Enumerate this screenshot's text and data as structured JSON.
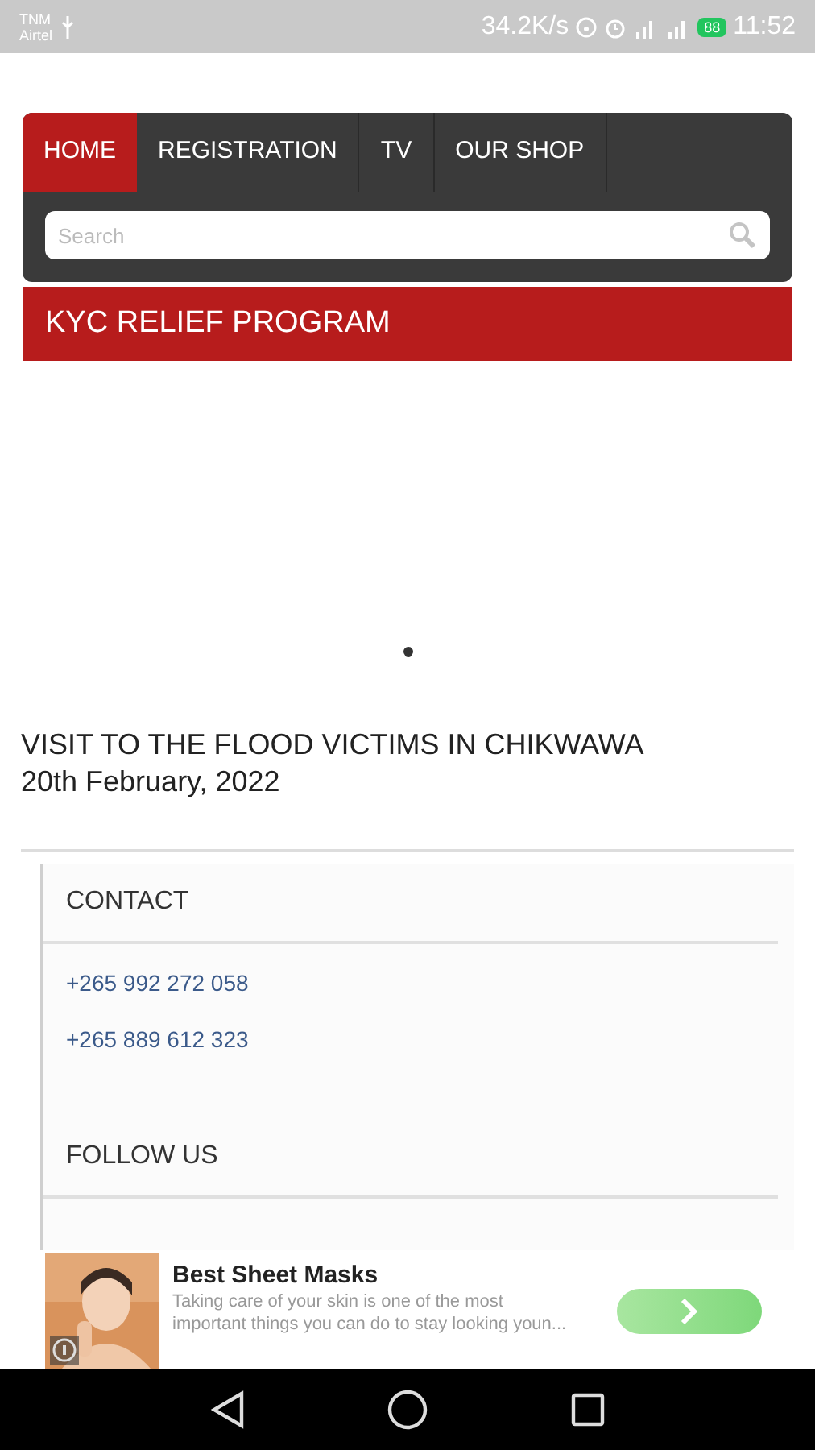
{
  "status_bar": {
    "carrier_1": "TNM",
    "carrier_2": "Airtel",
    "speed": "34.2K/s",
    "battery": "88",
    "time": "11:52"
  },
  "tabs": [
    {
      "label": "HOME",
      "selected": true
    },
    {
      "label": "REGISTRATION",
      "selected": false
    },
    {
      "label": "TV",
      "selected": false
    },
    {
      "label": "OUR SHOP",
      "selected": false
    }
  ],
  "search": {
    "placeholder": "Search"
  },
  "banner": {
    "title": "KYC RELIEF PROGRAM"
  },
  "post": {
    "title": "VISIT TO THE FLOOD VICTIMS IN CHIKWAWA",
    "date": "20th February, 2022"
  },
  "footer": {
    "contact_heading": "CONTACT",
    "phones": [
      "+265 992 272 058",
      "+265 889 612 323"
    ],
    "follow_heading": "FOLLOW US"
  },
  "ad": {
    "title": "Best Sheet Masks",
    "body": "Taking care of your skin is one of the most important things you can do to stay looking youn..."
  }
}
